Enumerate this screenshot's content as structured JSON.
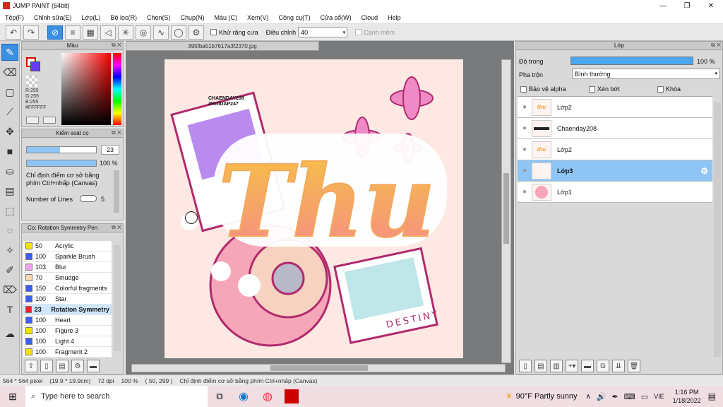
{
  "window": {
    "title": "JUMP PAINT (64bit)",
    "minimize": "—",
    "maximize": "❐",
    "close": "✕"
  },
  "menu": [
    "Tệp(F)",
    "Chỉnh sửa(E)",
    "Lớp(L)",
    "Bộ lọc(R)",
    "Chọn(S)",
    "Chụp(N)",
    "Màu (C)",
    "Xem(V)",
    "Công cụ(T)",
    "Cửa sổ(W)",
    "Cloud",
    "Help"
  ],
  "toolbar": {
    "antialias_label": "Khử răng cưa",
    "adjust_label": "Điều chỉnh",
    "adjust_value": "40",
    "edge_label": "Cạnh mềm"
  },
  "color_panel": {
    "title": "Màu",
    "r": "R:255",
    "g": "G:255",
    "b": "B:255",
    "hex": "#FFFFFF",
    "primary": "#ff0000",
    "secondary": "#6a3cff"
  },
  "brush_panel": {
    "title": "Kiểm soát cọ",
    "size": "23",
    "opacity": "100 %",
    "hint": "Chỉ định điểm cơ sở bằng phím Ctrl+nhấp (Canvas)",
    "lines_label": "Number of Lines",
    "lines_value": "5"
  },
  "brush_list": {
    "title": "Cọ: Rotation Symmetry Pen",
    "items": [
      {
        "size": "50",
        "name": "Acrylic",
        "color": "#f5e400"
      },
      {
        "size": "100",
        "name": "Sparkle Brush",
        "color": "#3b5cff"
      },
      {
        "size": "103",
        "name": "Blur",
        "color": "#f5a0f0"
      },
      {
        "size": "70",
        "name": "Smudge",
        "color": "#f7d9b0"
      },
      {
        "size": "150",
        "name": "Colorful fragments",
        "color": "#3b5cff"
      },
      {
        "size": "100",
        "name": "Star",
        "color": "#3b5cff"
      },
      {
        "size": "23",
        "name": "Rotation Symmetry Pen",
        "color": "#e22"
      },
      {
        "size": "100",
        "name": "Heart",
        "color": "#3b5cff"
      },
      {
        "size": "100",
        "name": "Figure 3",
        "color": "#f5e400"
      },
      {
        "size": "100",
        "name": "Light 4",
        "color": "#3b5cff"
      },
      {
        "size": "100",
        "name": "Fragment 2",
        "color": "#f5e400"
      }
    ]
  },
  "document": {
    "tab": "395fba51b7617a3f2370.jpg",
    "caption": "CHAENDAY208\n#HOIDAP247",
    "art_text": "Thu",
    "destiny": "DESTINY"
  },
  "layer_panel": {
    "title": "Lớp",
    "opacity_label": "Độ trong",
    "opacity_value": "100 %",
    "blend_label": "Pha trộn",
    "blend_value": "Bình thường",
    "protect_alpha": "Bảo vệ alpha",
    "clip": "Xén bớt",
    "lock": "Khóa",
    "layers": [
      {
        "name": "Lớp2",
        "thumb": "thu"
      },
      {
        "name": "Chaenday208",
        "thumb": "txt"
      },
      {
        "name": "Lớp2",
        "thumb": "thu"
      },
      {
        "name": "Lớp3",
        "thumb": ""
      },
      {
        "name": "Lớp1",
        "thumb": "art"
      }
    ]
  },
  "status": {
    "size": "564 * 564 pixel",
    "cm": "(19.9 * 19.9cm)",
    "dpi": "72 dpi",
    "zoom": "100 %",
    "coords": "( 50, 299 )",
    "hint": "Chỉ định điểm cơ sở bằng phím Ctrl+nhấp (Canvas)"
  },
  "taskbar": {
    "search": "Type here to search",
    "weather": "90°F  Partly sunny",
    "lang": "VIE",
    "time": "1:16 PM",
    "date": "1/18/2022"
  }
}
